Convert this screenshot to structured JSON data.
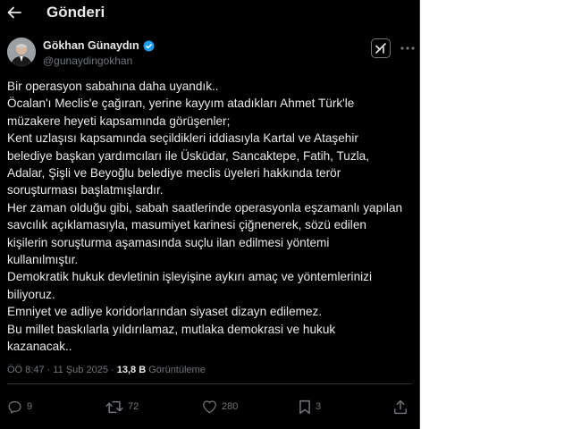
{
  "header": {
    "title": "Gönderi"
  },
  "author": {
    "name": "Gökhan Günaydın",
    "handle": "@gunaydingokhan",
    "verified": true
  },
  "tweet": {
    "lines": [
      "Bir operasyon sabahına daha uyandık..",
      "Öcalan'ı Meclis'e çağıran, yerine kayyım atadıkları Ahmet Türk'le",
      "müzakere heyeti kapsamında görüşenler;",
      "Kent uzlaşısı kapsamında seçildikleri iddiasıyla Kartal ve Ataşehir",
      "belediye başkan yardımcıları ile Üsküdar, Sancaktepe, Fatih, Tuzla,",
      "Adalar, Şişli ve Beyoğlu belediye meclis üyeleri hakkında terör",
      "soruşturması başlatmışlardır.",
      "Her zaman olduğu gibi, sabah saatlerinde operasyonla eşzamanlı yapılan",
      "savcılık açıklamasıyla, masumiyet karinesi çiğnenerek, sözü edilen",
      "kişilerin soruşturma aşamasında suçlu ilan edilmesi yöntemi",
      "kullanılmıştır.",
      "Demokratik hukuk devletinin işleyişine aykırı amaç ve yöntemlerinizi",
      "biliyoruz.",
      "Emniyet ve adliye koridorlarından siyaset dizayn edilemez.",
      "Bu millet baskılarla yıldırılamaz, mutlaka demokrasi ve hukuk",
      "kazanacak.."
    ]
  },
  "meta": {
    "time": "ÖÖ 8:47",
    "separator": "·",
    "date": "11 Şub 2025",
    "views": "13,8 B",
    "views_label": "Görüntüleme"
  },
  "actions": {
    "replies": "9",
    "reposts": "72",
    "likes": "280",
    "bookmarks": "3"
  },
  "colors": {
    "background": "#000000",
    "text": "#e7e9ea",
    "secondary": "#71767b",
    "verified": "#1d9bf0",
    "divider": "#2f3336"
  }
}
